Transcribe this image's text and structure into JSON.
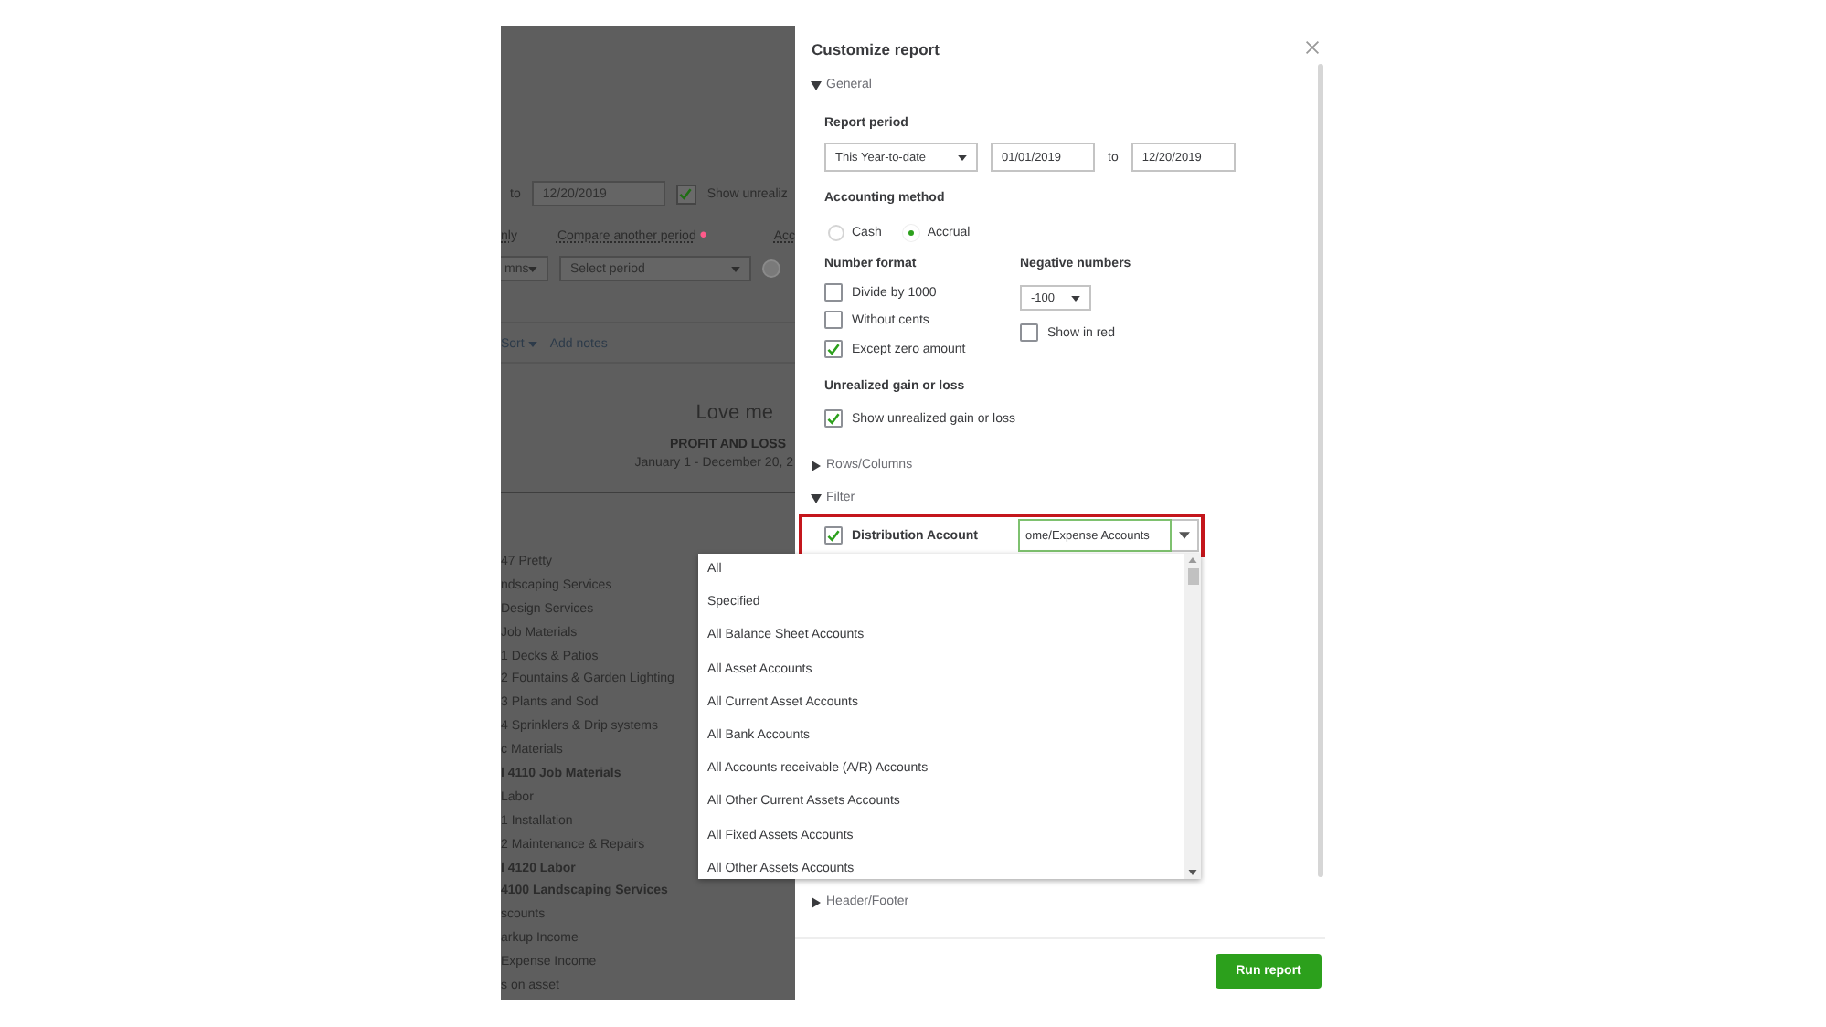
{
  "report_background": {
    "date_to_label": "to",
    "date_to": "12/20/2019",
    "show_unrealized": {
      "label": "Show unrealiz",
      "checked": true
    },
    "column_1_label": "nly",
    "compare_label": "Compare another period",
    "required_mark": "•",
    "column_3_label": "Acc",
    "columns_select": "mns",
    "compare_select": "Select period",
    "sort": "Sort",
    "add_notes": "Add notes",
    "company": "Love me",
    "report_title": "PROFIT AND LOSS",
    "date_range": "January 1 - December 20, 2",
    "rows": [
      {
        "label": "47 Pretty",
        "bold": false
      },
      {
        "label": "ndscaping Services",
        "bold": false
      },
      {
        "label": "Design Services",
        "bold": false
      },
      {
        "label": "Job Materials",
        "bold": false
      },
      {
        "label": "1 Decks & Patios",
        "bold": false
      },
      {
        "label": "2 Fountains & Garden Lighting",
        "bold": false
      },
      {
        "label": "3 Plants and Sod",
        "bold": false
      },
      {
        "label": "4 Sprinklers & Drip systems",
        "bold": false
      },
      {
        "label": "c Materials",
        "bold": false
      },
      {
        "label": "l 4110 Job Materials",
        "bold": true
      },
      {
        "label": "Labor",
        "bold": false
      },
      {
        "label": "1 Installation",
        "bold": false
      },
      {
        "label": "2 Maintenance & Repairs",
        "bold": false
      },
      {
        "label": "l 4120 Labor",
        "bold": true
      },
      {
        "label": "4100 Landscaping Services",
        "bold": true
      },
      {
        "label": "scounts",
        "bold": false
      },
      {
        "label": "arkup Income",
        "bold": false
      },
      {
        "label": "Expense Income",
        "bold": false
      },
      {
        "label": "s on asset",
        "bold": false
      }
    ]
  },
  "dialog": {
    "title": "Customize report",
    "general": {
      "label": "General",
      "expanded": true,
      "report_period": {
        "label": "Report period",
        "period": "This Year-to-date",
        "from": "01/01/2019",
        "to_label": "to",
        "to": "12/20/2019"
      },
      "accounting_method": {
        "label": "Accounting method",
        "options": [
          {
            "label": "Cash",
            "selected": false
          },
          {
            "label": "Accrual",
            "selected": true
          }
        ]
      },
      "number_format": {
        "label": "Number format",
        "options": [
          {
            "label": "Divide by 1000",
            "checked": false
          },
          {
            "label": "Without cents",
            "checked": false
          },
          {
            "label": "Except zero amount",
            "checked": true
          }
        ]
      },
      "negative_numbers": {
        "label": "Negative numbers",
        "value": "-100",
        "show_in_red": {
          "label": "Show in red",
          "checked": false
        }
      },
      "unrealized": {
        "label": "Unrealized gain or loss",
        "option": {
          "label": "Show unrealized gain or loss",
          "checked": true
        }
      }
    },
    "rows_columns": {
      "label": "Rows/Columns",
      "expanded": false
    },
    "filter": {
      "label": "Filter",
      "expanded": true,
      "distribution_account": {
        "label": "Distribution Account",
        "checked": true,
        "value": "ome/Expense Accounts",
        "highlighted": true
      }
    },
    "header_footer": {
      "label": "Header/Footer",
      "expanded": false
    },
    "run_button": "Run report"
  },
  "dropdown": {
    "options": [
      "All",
      "Specified",
      "All Balance Sheet Accounts",
      "All Asset Accounts",
      "All Current Asset Accounts",
      "All Bank Accounts",
      "All Accounts receivable (A/R) Accounts",
      "All Other Current Assets Accounts",
      "All Fixed Assets Accounts",
      "All Other Assets Accounts"
    ]
  }
}
